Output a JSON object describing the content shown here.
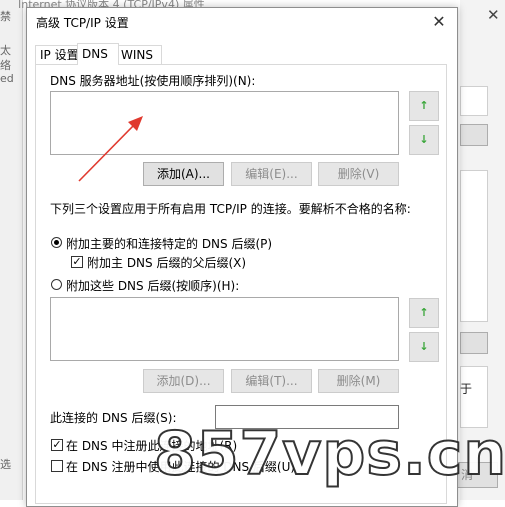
{
  "background": {
    "window_title": "Internet 协议版本 4 (TCP/IPv4) 属性",
    "left_fragments": [
      "禁",
      "太",
      "络",
      "ed",
      "选"
    ],
    "right_fragments": [
      "于",
      "消"
    ]
  },
  "dialog": {
    "title": "高级 TCP/IP 设置",
    "close_glyph": "✕",
    "tabs": [
      {
        "label": "IP 设置"
      },
      {
        "label": "DNS"
      },
      {
        "label": "WINS"
      }
    ],
    "dns_servers_label": "DNS 服务器地址(按使用顺序排列)(N):",
    "dns_servers": [],
    "up_arrow": "↑",
    "down_arrow": "↓",
    "dns_buttons": {
      "add": "添加(A)...",
      "edit": "编辑(E)...",
      "remove": "删除(V)"
    },
    "info_text": "下列三个设置应用于所有启用 TCP/IP 的连接。要解析不合格的名称:",
    "radio_primary": {
      "label": "附加主要的和连接特定的 DNS 后缀(P)",
      "selected": true
    },
    "check_parent": {
      "label": "附加主 DNS 后缀的父后缀(X)",
      "checked": true
    },
    "radio_suffixes": {
      "label": "附加这些 DNS 后缀(按顺序)(H):",
      "selected": false
    },
    "suffix_list": [],
    "suffix_buttons": {
      "add": "添加(D)...",
      "edit": "编辑(T)...",
      "remove": "删除(M)"
    },
    "conn_suffix_label": "此连接的 DNS 后缀(S):",
    "conn_suffix_value": "",
    "check_register": {
      "label": "在 DNS 中注册此连接的地址(R)",
      "checked": true
    },
    "check_use_suffix": {
      "label": "在 DNS 注册中使用此连接的 DNS 后缀(U)",
      "checked": false
    }
  },
  "annotation": {
    "arrow_color": "#e03a2f"
  },
  "watermark": {
    "text": "857vps.cn"
  }
}
